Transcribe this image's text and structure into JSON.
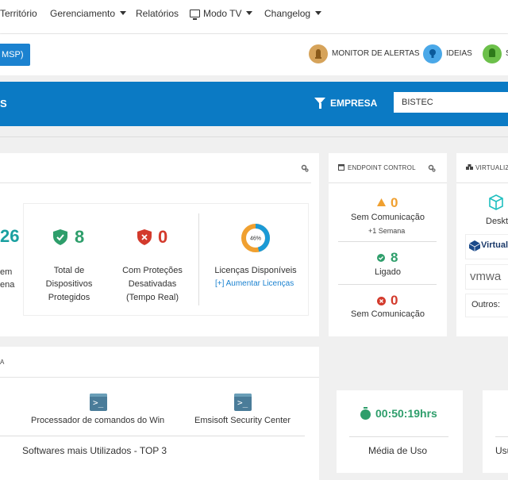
{
  "nav": {
    "items": [
      {
        "label": "Território",
        "caret": false
      },
      {
        "label": "Gerenciamento",
        "caret": true
      },
      {
        "label": "Relatórios",
        "caret": false
      },
      {
        "label": "Modo TV",
        "caret": true
      },
      {
        "label": "Changelog",
        "caret": true
      }
    ]
  },
  "subbar": {
    "msp_button": "MSP)",
    "monitor_label": "MONITOR DE ALERTAS",
    "ideias_label": "IDEIAS",
    "third_label": "S"
  },
  "filter": {
    "left_title": "S",
    "empresa_label": "EMPRESA",
    "empresa_value": "BISTEC"
  },
  "protection_card": {
    "partial_number": "26",
    "partial_label_1": "em",
    "partial_label_2": "ena",
    "total_protected": {
      "value": "8",
      "label": "Total de Dispositivos Protegidos"
    },
    "disabled_protection": {
      "value": "0",
      "label": "Com Proteções Desativadas (Tempo Real)"
    },
    "licenses": {
      "percent": "46%",
      "percent_value": 46,
      "label": "Licenças Disponíveis",
      "link": "[+] Aumentar Licenças"
    }
  },
  "endpoint_card": {
    "title": "ENDPOINT CONTROL",
    "no_comm_week": {
      "value": "0",
      "label": "Sem Comunicação",
      "sub": "+1 Semana"
    },
    "connected": {
      "value": "8",
      "label": "Ligado"
    },
    "no_comm": {
      "value": "0",
      "label": "Sem Comunicação"
    }
  },
  "virtual_card": {
    "title": "VIRTUALIZ",
    "desktop_label": "Deskt",
    "virtualbox_label": "Virtual",
    "vmware_label": "vmwa",
    "others_label": "Outros:"
  },
  "software_card": {
    "title": "A",
    "items": [
      {
        "label": "Processador de comandos do Win"
      },
      {
        "label": "Emsisoft Security Center"
      }
    ],
    "footer": "Softwares mais Utilizados - TOP 3"
  },
  "usage_card": {
    "time": "00:50:19hrs",
    "label": "Média de Uso"
  },
  "last_card": {
    "label": "Usu"
  },
  "colors": {
    "green": "#2e9e6b",
    "teal": "#1aa0a0",
    "red": "#d33a2c",
    "orange": "#f0a030",
    "blue": "#0b7ac4"
  }
}
